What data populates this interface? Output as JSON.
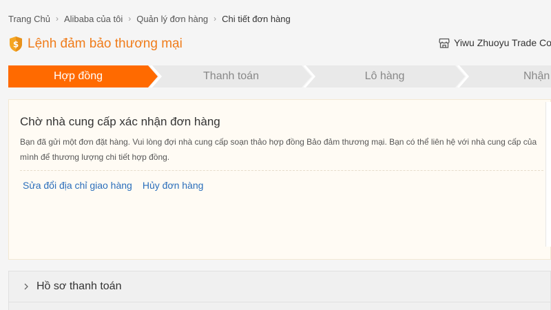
{
  "breadcrumb": {
    "items": [
      "Trang Chủ",
      "Alibaba của tôi",
      "Quản lý đơn hàng",
      "Chi tiết đơn hàng"
    ]
  },
  "header": {
    "title": "Lệnh đảm bảo thương mại",
    "supplier": "Yiwu Zhuoyu Trade Co",
    "icons": {
      "title": "shield-icon",
      "supplier": "store-icon"
    }
  },
  "steps": {
    "items": [
      "Hợp đồng",
      "Thanh toán",
      "Lô hàng",
      "Nhận"
    ],
    "active_index": 0
  },
  "notice": {
    "heading": "Chờ nhà cung cấp xác nhận đơn hàng",
    "body": "Bạn đã gửi một đơn đặt hàng. Vui lòng đợi nhà cung cấp soạn thảo hợp đồng Bảo đảm thương mại. Bạn có thể liên hệ với nhà cung cấp của mình để thương lượng chi tiết hợp đồng.",
    "actions": [
      "Sửa đổi địa chỉ giao hàng",
      "Hủy đơn hàng"
    ]
  },
  "sections": {
    "payment_records": "Hồ sơ thanh toán"
  },
  "colors": {
    "accent": "#ff6a00",
    "title": "#f07c1a",
    "link": "#2a6ebb",
    "step_inactive_bg": "#e9e9e9",
    "notice_bg": "#fffbf4"
  }
}
